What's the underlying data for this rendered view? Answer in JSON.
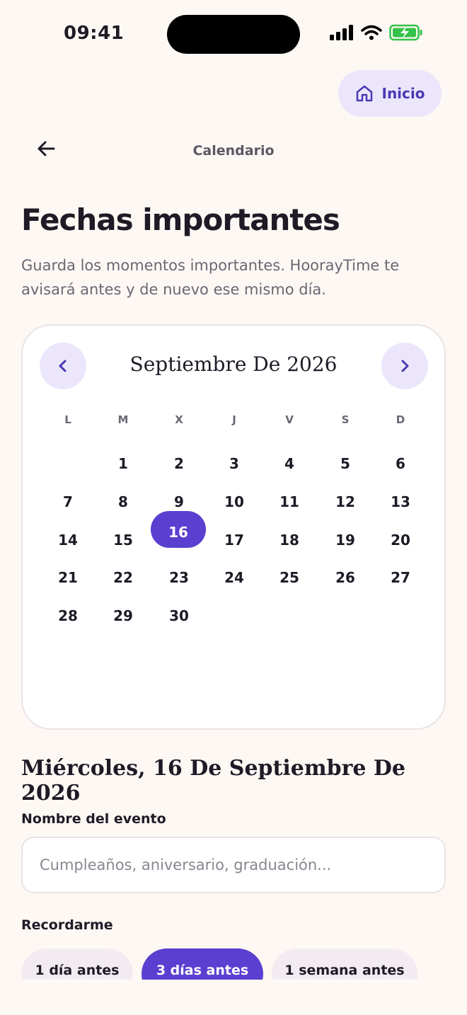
{
  "status_bar": {
    "time": "09:41"
  },
  "header": {
    "home_label": "Inicio",
    "nav_title": "Calendario"
  },
  "page": {
    "title": "Fechas importantes",
    "subtitle": "Guarda los momentos importantes. HoorayTime te avisará antes y de nuevo ese mismo día."
  },
  "calendar": {
    "month_label": "Septiembre De 2026",
    "weekdays": [
      "L",
      "M",
      "X",
      "J",
      "V",
      "S",
      "D"
    ],
    "days": [
      "1",
      "2",
      "3",
      "4",
      "5",
      "6",
      "7",
      "8",
      "9",
      "10",
      "11",
      "12",
      "13",
      "14",
      "15",
      "16",
      "17",
      "18",
      "19",
      "20",
      "21",
      "22",
      "23",
      "24",
      "25",
      "26",
      "27",
      "28",
      "29",
      "30"
    ],
    "selected_day": "16"
  },
  "selected_date_label": "Miércoles, 16 De Septiembre De 2026",
  "event_form": {
    "name_label": "Nombre del evento",
    "name_value": "",
    "name_placeholder": "Cumpleaños, aniversario, graduación...",
    "remind_label": "Recordarme",
    "remind_options": [
      "1 día antes",
      "3 días antes",
      "1 semana antes"
    ],
    "remind_selected": "3 días antes"
  },
  "colors": {
    "accent": "#5a3fd0",
    "accent_soft": "#ebe6fb",
    "background": "#fdf8f3"
  }
}
